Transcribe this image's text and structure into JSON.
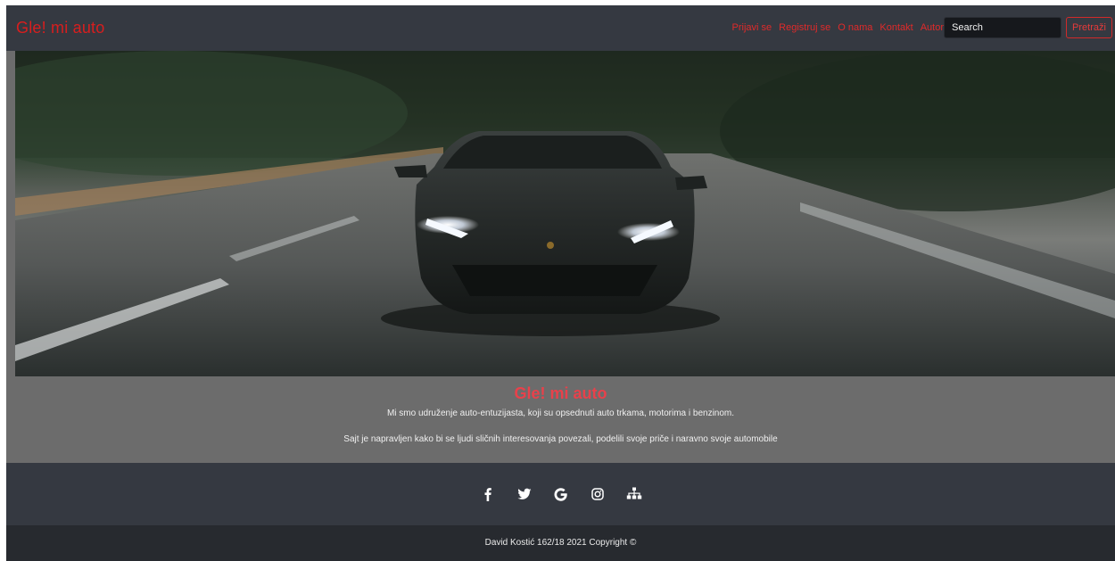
{
  "navbar": {
    "brand": "Gle! mi auto",
    "links": [
      "Prijavi se",
      "Registruj se",
      "O nama",
      "Kontakt",
      "Autor"
    ],
    "search_placeholder": "Search",
    "search_button": "Pretraži"
  },
  "about": {
    "title": "Gle! mi auto",
    "paragraph1": "Mi smo udruženje auto-entuzijasta, koji su opsednuti auto trkama, motorima i benzinom.",
    "paragraph2": "Sajt je napravljen kako bi se ljudi sličnih interesovanja povezali, podelili svoje priče i naravno svoje automobile"
  },
  "footer": {
    "social_icons": [
      "facebook-icon",
      "twitter-icon",
      "google-icon",
      "instagram-icon",
      "sitemap-icon"
    ],
    "copyright": "David Kostić 162/18 2021 Copyright ©"
  },
  "colors": {
    "navbar_bg": "#353941",
    "accent_red": "#e02a2a",
    "about_bg": "#6c6c6c",
    "footer_bottom_bg": "#272a2f"
  }
}
